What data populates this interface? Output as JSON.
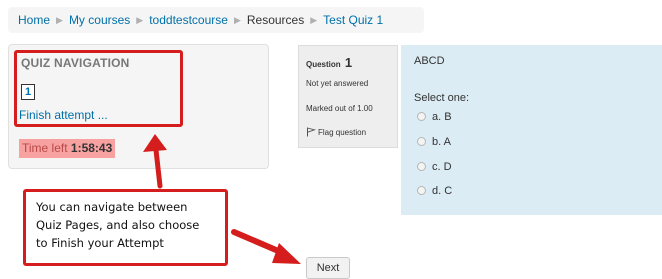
{
  "breadcrumb": {
    "items": [
      "Home",
      "My courses",
      "toddtestcourse",
      "Resources",
      "Test Quiz 1"
    ]
  },
  "quiz_navigation": {
    "title": "QUIZ NAVIGATION",
    "question_button": "1",
    "finish_link": "Finish attempt ...",
    "time_left_label": "Time left",
    "time_left_value": "1:58:43"
  },
  "question_info": {
    "label": "Question",
    "number": "1",
    "state": "Not yet answered",
    "grade": "Marked out of 1.00",
    "flag_label": "Flag question"
  },
  "question": {
    "text": "ABCD",
    "prompt": "Select one:",
    "options": [
      "a. B",
      "b. A",
      "c. D",
      "d. C"
    ]
  },
  "next_button": "Next",
  "callout": {
    "lines": [
      "You can navigate between",
      "Quiz Pages, and also choose",
      "to Finish your Attempt"
    ]
  },
  "colors": {
    "link": "#0070a8",
    "annotation_red": "#d51d1d",
    "question_bg": "#dbecf4",
    "timer_bg": "#f7a1a1"
  }
}
